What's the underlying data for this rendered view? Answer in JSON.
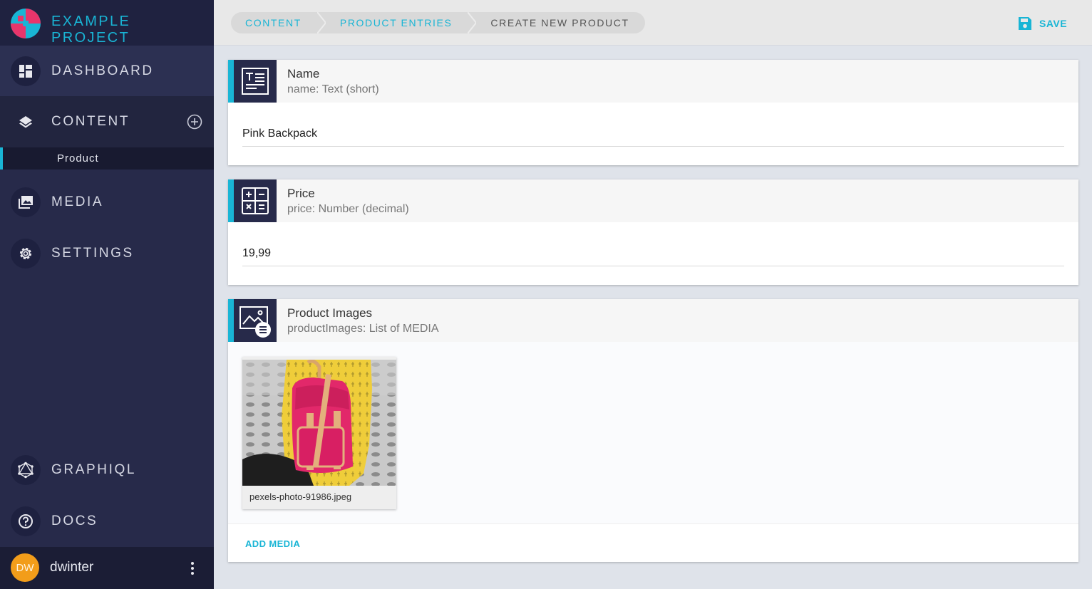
{
  "brand": {
    "title": "EXAMPLE PROJECT"
  },
  "sidebar": {
    "items": [
      {
        "label": "DASHBOARD"
      },
      {
        "label": "CONTENT"
      },
      {
        "label": "MEDIA"
      },
      {
        "label": "SETTINGS"
      },
      {
        "label": "GRAPHIQL"
      },
      {
        "label": "DOCS"
      }
    ],
    "content_children": [
      {
        "label": "Product"
      }
    ]
  },
  "user": {
    "initials": "DW",
    "name": "dwinter"
  },
  "breadcrumb": [
    {
      "label": "CONTENT"
    },
    {
      "label": "PRODUCT ENTRIES"
    },
    {
      "label": "CREATE NEW PRODUCT"
    }
  ],
  "toolbar": {
    "save_label": "SAVE"
  },
  "fields": [
    {
      "title": "Name",
      "subtitle": "name: Text (short)",
      "value": "Pink Backpack"
    },
    {
      "title": "Price",
      "subtitle": "price: Number (decimal)",
      "value": "19,99"
    },
    {
      "title": "Product Images",
      "subtitle": "productImages: List of MEDIA"
    }
  ],
  "media": [
    {
      "filename": "pexels-photo-91986.jpeg"
    }
  ],
  "actions": {
    "add_media_label": "ADD MEDIA"
  },
  "colors": {
    "accent": "#19b5d5",
    "sidebar": "#272a4a",
    "avatar": "#f29d1a"
  }
}
